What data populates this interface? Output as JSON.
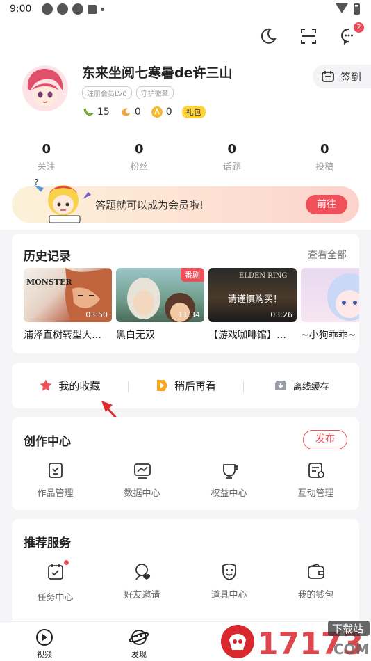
{
  "status_bar": {
    "time": "9:00"
  },
  "header": {
    "notification_count": "2"
  },
  "profile": {
    "username": "东来坐阅七寒暑de许三山",
    "tags": [
      "注册会员LV0",
      "守护徽章"
    ],
    "currencies": [
      {
        "icon": "banana-icon",
        "value": "15"
      },
      {
        "icon": "bean-icon",
        "value": "0"
      },
      {
        "icon": "coin-icon",
        "value": "0"
      }
    ],
    "gift_label": "礼包",
    "signin_label": "签到"
  },
  "stats": [
    {
      "num": "0",
      "label": "关注"
    },
    {
      "num": "0",
      "label": "粉丝"
    },
    {
      "num": "0",
      "label": "话题"
    },
    {
      "num": "0",
      "label": "投稿"
    }
  ],
  "banner": {
    "text": "答题就可以成为会员啦!",
    "button": "前往"
  },
  "history": {
    "title": "历史记录",
    "see_all": "查看全部",
    "items": [
      {
        "caption": "浦泽直树转型大…",
        "duration": "03:50",
        "brand": "MONSTER"
      },
      {
        "caption": "黑白无双",
        "duration": "11:34",
        "badge": "番剧"
      },
      {
        "caption": "【游戏咖啡馆】…",
        "duration": "03:26",
        "overlay": "请谨慎购买！",
        "brand": "ELDEN RING"
      },
      {
        "caption": "~小狗乖乖~"
      }
    ]
  },
  "quick_actions": [
    {
      "label": "我的收藏",
      "icon": "star-icon"
    },
    {
      "label": "稍后再看",
      "icon": "play-later-icon"
    },
    {
      "label": "离线缓存",
      "icon": "download-icon"
    }
  ],
  "create_center": {
    "title": "创作中心",
    "publish": "发布",
    "items": [
      {
        "label": "作品管理",
        "icon": "works-icon"
      },
      {
        "label": "数据中心",
        "icon": "data-icon"
      },
      {
        "label": "权益中心",
        "icon": "rights-icon"
      },
      {
        "label": "互动管理",
        "icon": "interaction-icon"
      }
    ]
  },
  "recommend": {
    "title": "推荐服务",
    "items": [
      {
        "label": "任务中心",
        "icon": "task-icon"
      },
      {
        "label": "好友邀请",
        "icon": "invite-icon"
      },
      {
        "label": "道具中心",
        "icon": "props-icon"
      },
      {
        "label": "我的钱包",
        "icon": "wallet-icon"
      }
    ]
  },
  "tabbar": [
    {
      "label": "视频",
      "icon": "video-tab-icon"
    },
    {
      "label": "发现",
      "icon": "discover-tab-icon"
    }
  ],
  "watermark": {
    "main": "17173",
    "sub": "下载站",
    "domain": "COM"
  }
}
